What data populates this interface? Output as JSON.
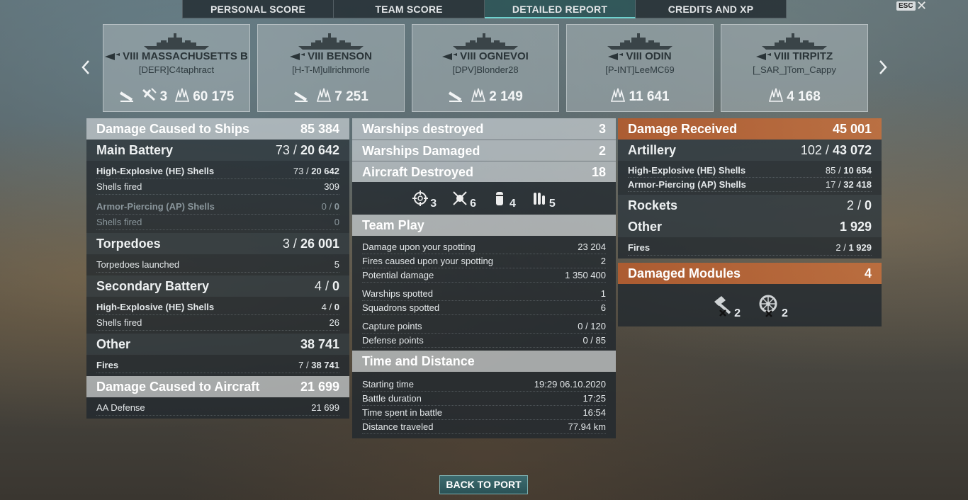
{
  "tabs": [
    "PERSONAL SCORE",
    "TEAM SCORE",
    "DETAILED REPORT",
    "CREDITS AND XP"
  ],
  "active_tab": "DETAILED REPORT",
  "esc_label": "ESC",
  "close_glyph": "✕",
  "nav": {
    "left": "‹",
    "right": "›"
  },
  "ships": [
    {
      "tier": "VIII",
      "name": "MASSACHUSETTS B",
      "player": "[DEFR]C4taphract",
      "icons": [
        "torpedo-hit-icon",
        "plane-kill-icon",
        "damage-burst-icon"
      ],
      "planes": "3",
      "damage": "60 175"
    },
    {
      "tier": "VIII",
      "name": "BENSON",
      "player": "[H-T-M]ullrichmorle",
      "icons": [
        "torpedo-hit-icon",
        "damage-burst-icon"
      ],
      "damage": "7 251"
    },
    {
      "tier": "VIII",
      "name": "OGNEVOI",
      "player": "[DPV]Blonder28",
      "icons": [
        "torpedo-hit-icon",
        "damage-burst-icon"
      ],
      "damage": "2 149"
    },
    {
      "tier": "VIII",
      "name": "ODIN",
      "player": "[P-INT]LeeMC69",
      "icons": [
        "damage-burst-icon"
      ],
      "damage": "11 641"
    },
    {
      "tier": "VIII",
      "name": "TIRPITZ",
      "player": "[_SAR_]Tom_Cappy",
      "icons": [
        "damage-burst-icon"
      ],
      "damage": "4 168"
    }
  ],
  "left": {
    "dmg_ships": {
      "label": "Damage Caused to Ships",
      "value": "85 384"
    },
    "main_battery": {
      "label": "Main Battery",
      "hits": "73",
      "dmg": "20 642"
    },
    "mb_he": {
      "label": "High-Explosive (HE) Shells",
      "hits": "73",
      "dmg": "20 642"
    },
    "mb_he_fired": {
      "label": "Shells fired",
      "value": "309"
    },
    "mb_ap": {
      "label": "Armor-Piercing (AP) Shells",
      "hits": "0",
      "dmg": "0"
    },
    "mb_ap_fired": {
      "label": "Shells fired",
      "value": "0"
    },
    "torpedoes": {
      "label": "Torpedoes",
      "hits": "3",
      "dmg": "26 001"
    },
    "torp_launched": {
      "label": "Torpedoes launched",
      "value": "5"
    },
    "secondary": {
      "label": "Secondary Battery",
      "hits": "4",
      "dmg": "0"
    },
    "sec_he": {
      "label": "High-Explosive (HE) Shells",
      "hits": "4",
      "dmg": "0"
    },
    "sec_fired": {
      "label": "Shells fired",
      "value": "26"
    },
    "other": {
      "label": "Other",
      "value": "38 741"
    },
    "fires": {
      "label": "Fires",
      "hits": "7",
      "dmg": "38 741"
    },
    "dmg_aircraft": {
      "label": "Damage Caused to Aircraft",
      "value": "21 699"
    },
    "aa_defense": {
      "label": "AA Defense",
      "value": "21 699"
    }
  },
  "middle": {
    "destroyed": {
      "label": "Warships destroyed",
      "value": "3"
    },
    "damaged": {
      "label": "Warships Damaged",
      "value": "2"
    },
    "aircraft": {
      "label": "Aircraft Destroyed",
      "value": "18"
    },
    "ribbons": [
      {
        "icon": "crosshair-icon",
        "value": "3"
      },
      {
        "icon": "incapacitation-icon",
        "value": "6"
      },
      {
        "icon": "flooding-icon",
        "value": "4"
      },
      {
        "icon": "shells-icon",
        "value": "5"
      }
    ],
    "team_play": {
      "title": "Team Play",
      "rows": [
        {
          "label": "Damage upon your spotting",
          "value": "23 204"
        },
        {
          "label": "Fires caused upon your spotting",
          "value": "2"
        },
        {
          "label": "Potential damage",
          "value": "1 350 400"
        },
        {
          "label": "Warships spotted",
          "value": "1"
        },
        {
          "label": "Squadrons spotted",
          "value": "6"
        },
        {
          "label": "Capture points",
          "value": "0 / 120"
        },
        {
          "label": "Defense points",
          "value": "0 / 85"
        }
      ]
    },
    "time": {
      "title": "Time and Distance",
      "rows": [
        {
          "label": "Starting time",
          "value": "19:29  06.10.2020"
        },
        {
          "label": "Battle duration",
          "value": "17:25"
        },
        {
          "label": "Time spent in battle",
          "value": "16:54"
        },
        {
          "label": "Distance traveled",
          "value": "77.94 km"
        }
      ]
    }
  },
  "right": {
    "received": {
      "label": "Damage Received",
      "value": "45 001"
    },
    "artillery": {
      "label": "Artillery",
      "hits": "102",
      "dmg": "43 072"
    },
    "art_he": {
      "label": "High-Explosive (HE) Shells",
      "hits": "85",
      "dmg": "10 654"
    },
    "art_ap": {
      "label": "Armor-Piercing (AP) Shells",
      "hits": "17",
      "dmg": "32 418"
    },
    "rockets": {
      "label": "Rockets",
      "hits": "2",
      "dmg": "0"
    },
    "other": {
      "label": "Other",
      "value": "1 929"
    },
    "fires": {
      "label": "Fires",
      "hits": "2",
      "dmg": "1 929"
    },
    "modules": {
      "label": "Damaged Modules",
      "value": "4"
    },
    "module_icons": [
      {
        "icon": "gun-module-icon",
        "value": "2"
      },
      {
        "icon": "steering-module-icon",
        "value": "2"
      }
    ]
  },
  "back_button": "BACK TO PORT",
  "colors": {
    "active_tab": "#2c5456",
    "accent": "#6fd2cf",
    "received_header": "#b05c30"
  }
}
